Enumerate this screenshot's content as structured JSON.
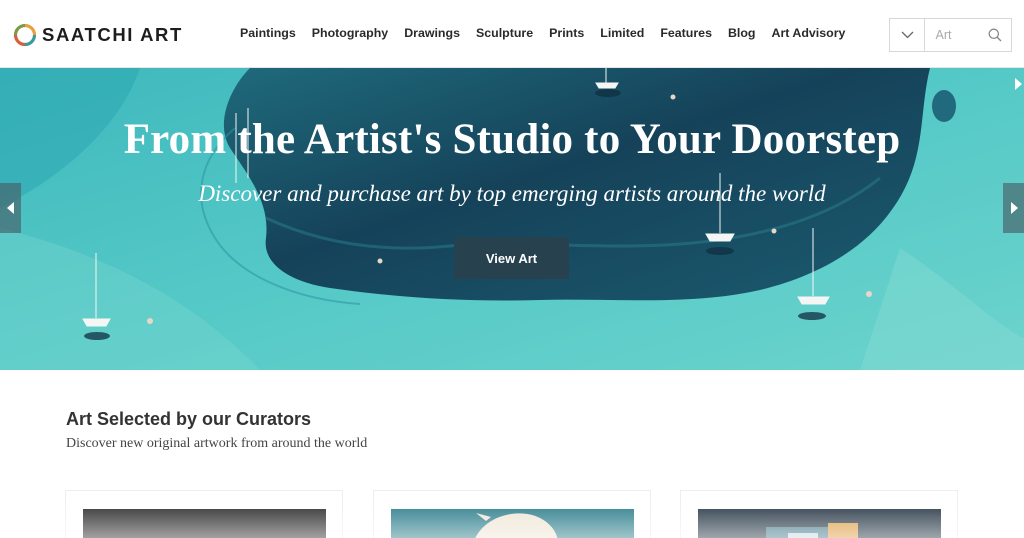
{
  "header": {
    "logo_text": "SAATCHI ART",
    "nav": [
      "Paintings",
      "Photography",
      "Drawings",
      "Sculpture",
      "Prints",
      "Limited",
      "Features",
      "Blog",
      "Art Advisory"
    ],
    "search": {
      "placeholder": "Art",
      "value": ""
    }
  },
  "hero": {
    "title": "From the Artist's Studio to Your Doorstep",
    "subtitle": "Discover and purchase art by top emerging artists around the world",
    "cta_label": "View Art"
  },
  "curated": {
    "title": "Art Selected by our Curators",
    "subtitle": "Discover new original artwork from around the world"
  },
  "colors": {
    "hero_water": "#4fc4c4",
    "hero_deep": "#17405a",
    "cta_bg": "#27414f",
    "logo_orange": "#e8a13a",
    "logo_teal": "#3a9aa0"
  },
  "icons": [
    "chevron-down-icon",
    "search-icon",
    "chevron-left-icon",
    "chevron-right-icon"
  ]
}
